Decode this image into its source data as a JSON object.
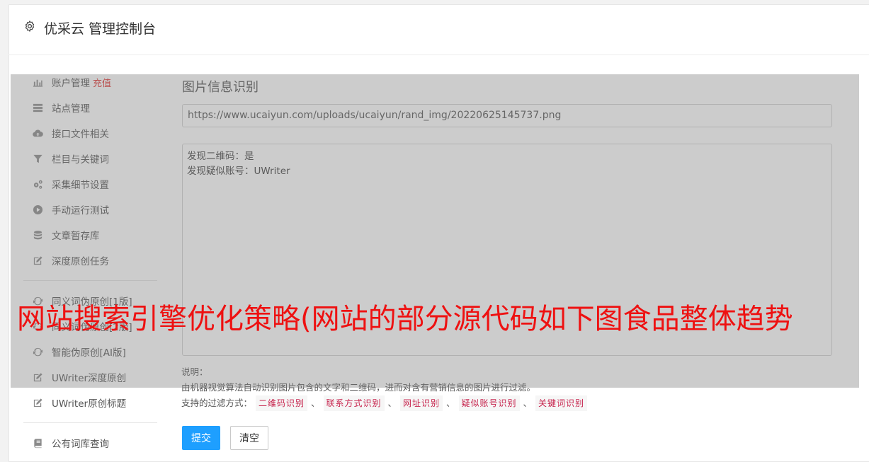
{
  "header": {
    "title": "优采云 管理控制台",
    "icon": "gear-icon"
  },
  "sidebar": {
    "items": [
      {
        "label": "账户管理",
        "badge": "充值",
        "icon": "bar-chart-icon"
      },
      {
        "label": "站点管理",
        "icon": "server-icon"
      },
      {
        "label": "接口文件相关",
        "icon": "cloud-upload-icon"
      },
      {
        "label": "栏目与关键词",
        "icon": "filter-icon"
      },
      {
        "label": "采集细节设置",
        "icon": "gears-icon"
      },
      {
        "label": "手动运行测试",
        "icon": "play-circle-icon"
      },
      {
        "label": "文章暂存库",
        "icon": "database-icon"
      },
      {
        "label": "深度原创任务",
        "icon": "edit-icon"
      },
      {
        "label": "同义词伪原创[1版]",
        "icon": "refresh-icon"
      },
      {
        "label": "同义词伪原创[2版]",
        "icon": "refresh-icon"
      },
      {
        "label": "智能伪原创[AI版]",
        "icon": "refresh-icon"
      },
      {
        "label": "UWriter深度原创",
        "icon": "edit-icon"
      },
      {
        "label": "UWriter原创标题",
        "icon": "edit-icon"
      },
      {
        "label": "公有词库查询",
        "icon": "book-icon"
      }
    ]
  },
  "main": {
    "heading": "图片信息识别",
    "url_value": "https://www.ucaiyun.com/uploads/ucaiyun/rand_img/20220625145737.png",
    "result_lines": [
      "发现二维码：是",
      "发现疑似账号：UWriter"
    ],
    "note_label": "说明：",
    "note_text": "由机器视觉算法自动识别图片包含的文字和二维码，进而对含有营销信息的图片进行过滤。",
    "filter_label": "支持的过滤方式：",
    "filters": [
      "二维码识别",
      "联系方式识别",
      "网址识别",
      "疑似账号识别",
      "关键词识别"
    ],
    "filter_sep": "、",
    "submit_label": "提交",
    "clear_label": "清空"
  },
  "overlay_banner": "网站搜索引擎优化策略(网站的部分源代码如下图食品整体趋势",
  "colors": {
    "accent": "#1e9fff",
    "badge": "#e0302d",
    "banner": "#ee1111",
    "tag": "#c7254e"
  }
}
